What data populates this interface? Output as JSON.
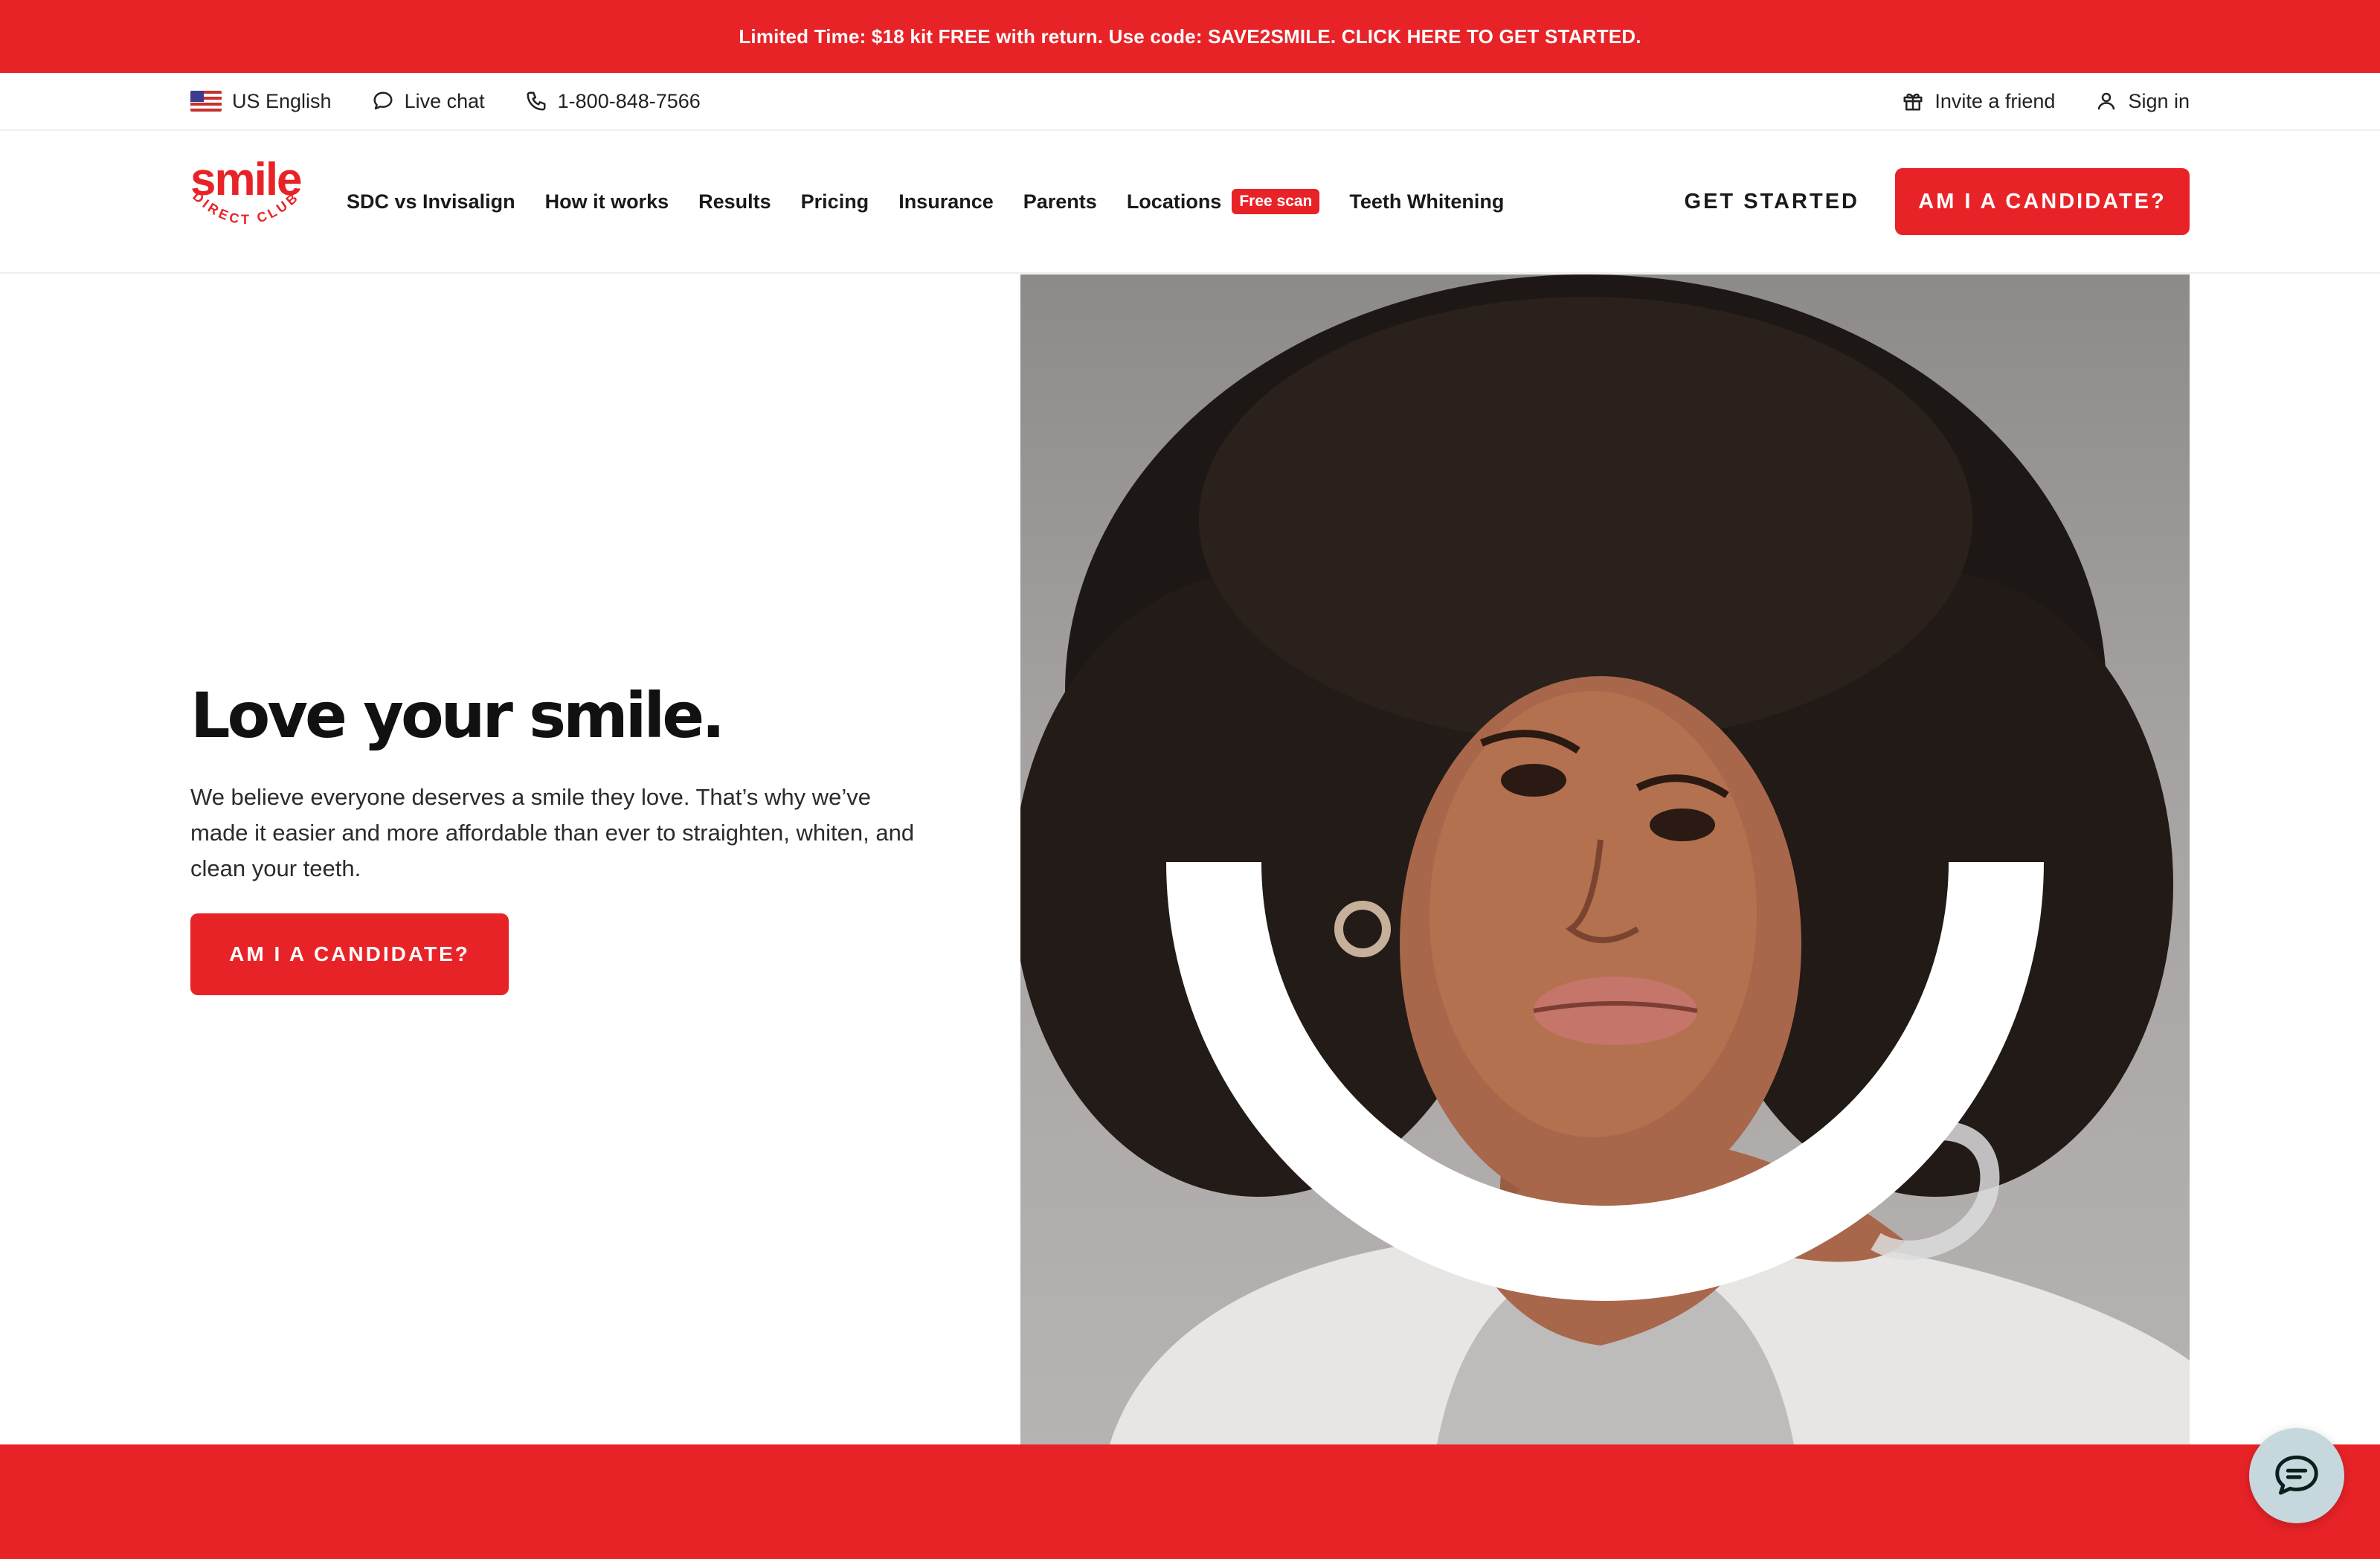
{
  "promo": {
    "text": "Limited Time: $18 kit FREE with return. Use code: SAVE2SMILE. CLICK HERE TO GET STARTED."
  },
  "utility": {
    "language": "US English",
    "live_chat": "Live chat",
    "phone": "1-800-848-7566",
    "invite": "Invite a friend",
    "sign_in": "Sign in"
  },
  "logo": {
    "word": "smile",
    "tagline": "DIRECT CLUB"
  },
  "nav": {
    "items": [
      {
        "label": "SDC vs Invisalign"
      },
      {
        "label": "How it works"
      },
      {
        "label": "Results"
      },
      {
        "label": "Pricing"
      },
      {
        "label": "Insurance"
      },
      {
        "label": "Parents"
      },
      {
        "label": "Locations",
        "badge": "Free scan"
      },
      {
        "label": "Teeth Whitening"
      }
    ],
    "get_started": "GET STARTED",
    "cta": "AM I A CANDIDATE?"
  },
  "hero": {
    "title": "Love your smile.",
    "body": "We believe everyone deserves a smile they love. That’s why we’ve made it easier and more affordable than ever to straighten, whiten, and clean your teeth.",
    "cta": "AM I A CANDIDATE?"
  },
  "colors": {
    "brand_red": "#e82327",
    "chat_bubble": "#c6d7dd"
  },
  "icons": {
    "flag": "us-flag-icon",
    "chat": "chat-bubble-icon",
    "phone": "phone-icon",
    "invite": "gift-icon",
    "sign_in": "user-icon",
    "floating_chat": "chat-icon"
  }
}
